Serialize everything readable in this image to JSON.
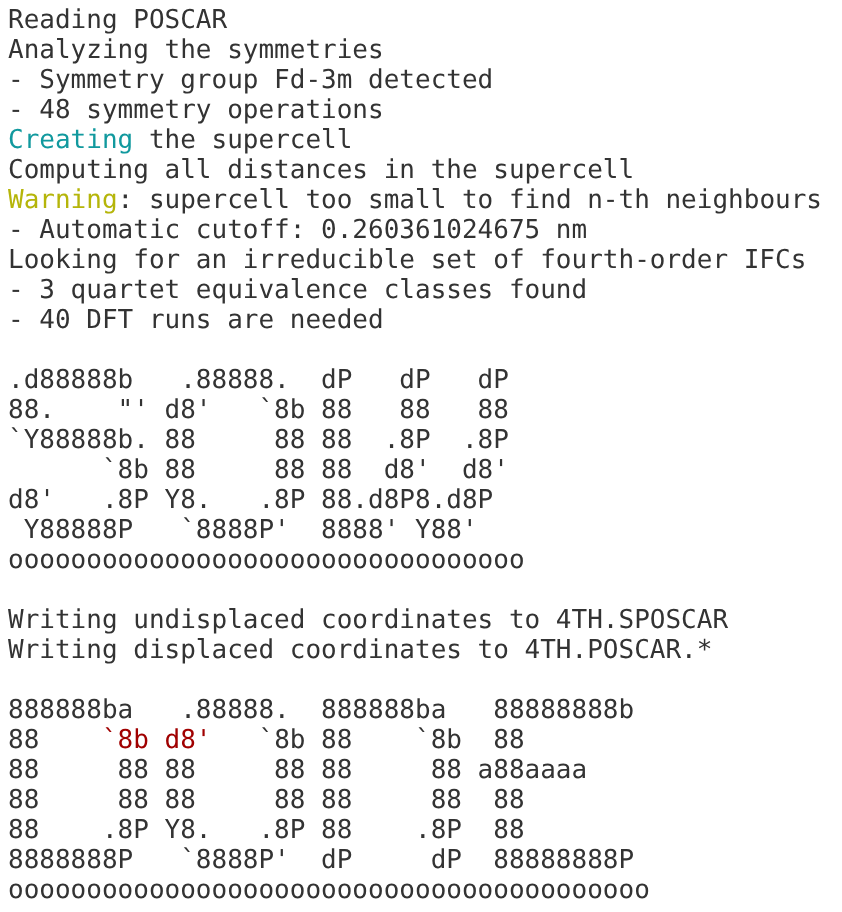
{
  "terminal": {
    "blocks": [
      {
        "lines": [
          {
            "parts": [
              {
                "text": "Reading POSCAR"
              }
            ]
          },
          {
            "parts": [
              {
                "text": "Analyzing the symmetries"
              }
            ]
          },
          {
            "parts": [
              {
                "text": "- Symmetry group Fd-3m detected"
              }
            ]
          },
          {
            "parts": [
              {
                "text": "- 48 symmetry operations"
              }
            ]
          },
          {
            "parts": [
              {
                "text": "Creating",
                "color": "#11999e"
              },
              {
                "text": " the supercell"
              }
            ]
          },
          {
            "parts": [
              {
                "text": "Computing all distances in the supercell"
              }
            ]
          },
          {
            "parts": [
              {
                "text": "Warning",
                "color": "#b5b50a"
              },
              {
                "text": ": supercell too small to find n-th neighbours"
              }
            ]
          },
          {
            "parts": [
              {
                "text": "- Automatic cutoff: 0.260361024675 nm"
              }
            ]
          },
          {
            "parts": [
              {
                "text": "Looking for an irreducible set of fourth-order IFCs"
              }
            ]
          },
          {
            "parts": [
              {
                "text": "- 3 quartet equivalence classes found"
              }
            ]
          },
          {
            "parts": [
              {
                "text": "- 40 DFT runs are needed"
              }
            ]
          }
        ]
      },
      {
        "lines": [
          {
            "parts": [
              {
                "text": ".d88888b   .88888.  dP   dP   dP"
              }
            ]
          },
          {
            "parts": [
              {
                "text": "88.    \"' d8'   `8b 88   88   88"
              }
            ]
          },
          {
            "parts": [
              {
                "text": "`Y88888b. 88     88 88  .8P  .8P"
              }
            ]
          },
          {
            "parts": [
              {
                "text": "      `8b 88     88 88  d8'  d8'"
              }
            ]
          },
          {
            "parts": [
              {
                "text": "d8'   .8P Y8.   .8P 88.d8P8.d8P"
              }
            ]
          },
          {
            "parts": [
              {
                "text": " Y88888P   `8888P'  8888' Y88'"
              }
            ]
          },
          {
            "parts": [
              {
                "text": "ooooooooooooooooooooooooooooooooo"
              }
            ]
          }
        ]
      },
      {
        "lines": [
          {
            "parts": [
              {
                "text": "Writing undisplaced coordinates to 4TH.SPOSCAR"
              }
            ]
          },
          {
            "parts": [
              {
                "text": "Writing displaced coordinates to 4TH.POSCAR.*"
              }
            ]
          }
        ]
      },
      {
        "lines": [
          {
            "parts": [
              {
                "text": "888888ba   .88888.  888888ba   88888888b"
              }
            ]
          },
          {
            "parts": [
              {
                "text": "88    "
              },
              {
                "text": "`8b d8'",
                "color": "#a00000"
              },
              {
                "text": "   `8b 88    `8b  88"
              }
            ]
          },
          {
            "parts": [
              {
                "text": "88     88 88     88 88     88 a88aaaa"
              }
            ]
          },
          {
            "parts": [
              {
                "text": "88     88 88     88 88     88  88"
              }
            ]
          },
          {
            "parts": [
              {
                "text": "88    .8P Y8.   .8P 88    .8P  88"
              }
            ]
          },
          {
            "parts": [
              {
                "text": "8888888P   `8888P'  dP     dP  88888888P"
              }
            ]
          },
          {
            "parts": [
              {
                "text": "ooooooooooooooooooooooooooooooooooooooooo"
              }
            ]
          }
        ]
      }
    ]
  }
}
